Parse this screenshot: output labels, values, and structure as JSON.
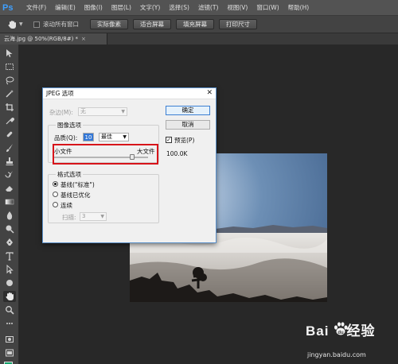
{
  "app": {
    "logo": "Ps"
  },
  "menubar": {
    "items": [
      "文件(F)",
      "编辑(E)",
      "图像(I)",
      "图层(L)",
      "文字(Y)",
      "选择(S)",
      "滤镜(T)",
      "视图(V)",
      "窗口(W)",
      "帮助(H)"
    ]
  },
  "options_bar": {
    "scroll_all_windows_label": "滚动所有窗口",
    "scroll_all_windows_checked": false,
    "buttons": [
      "实际像素",
      "适合屏幕",
      "填充屏幕",
      "打印尺寸"
    ]
  },
  "document_tab": {
    "label": "云海.jpg @ 50%(RGB/8#) *",
    "close": "×"
  },
  "toolbar": {
    "icons": [
      "move-icon",
      "marquee-icon",
      "lasso-icon",
      "magic-wand-icon",
      "crop-icon",
      "eyedropper-icon",
      "healing-brush-icon",
      "brush-icon",
      "clone-stamp-icon",
      "history-brush-icon",
      "eraser-icon",
      "gradient-icon",
      "blur-icon",
      "dodge-icon",
      "pen-icon",
      "type-icon",
      "path-selection-icon",
      "shape-icon",
      "hand-icon",
      "zoom-icon"
    ],
    "active": "hand-icon",
    "colors": {
      "foreground": "#14a26b",
      "background": "#000000"
    }
  },
  "dialog": {
    "title": "JPEG 选项",
    "close": "✕",
    "matte_label": "杂边(M):",
    "matte_value": "无",
    "image_options_title": "图像选项",
    "quality_label": "品质(Q):",
    "quality_value": "10",
    "quality_preset": "最佳",
    "small_file_label": "小文件",
    "large_file_label": "大文件",
    "quality_slider_fraction": 0.83,
    "format_options_title": "格式选项",
    "format_options": [
      "基线(\"标准\")",
      "基线已优化",
      "连续"
    ],
    "format_selected": 0,
    "scans_label": "扫描:",
    "scans_value": "3",
    "ok_label": "确定",
    "cancel_label": "取消",
    "preview_label": "预览(P)",
    "preview_checked": true,
    "file_size": "100.0K",
    "highlight_color": "#d7141a"
  },
  "watermark": {
    "brand": "Bai 经验",
    "url": "jingyan.baidu.com"
  }
}
